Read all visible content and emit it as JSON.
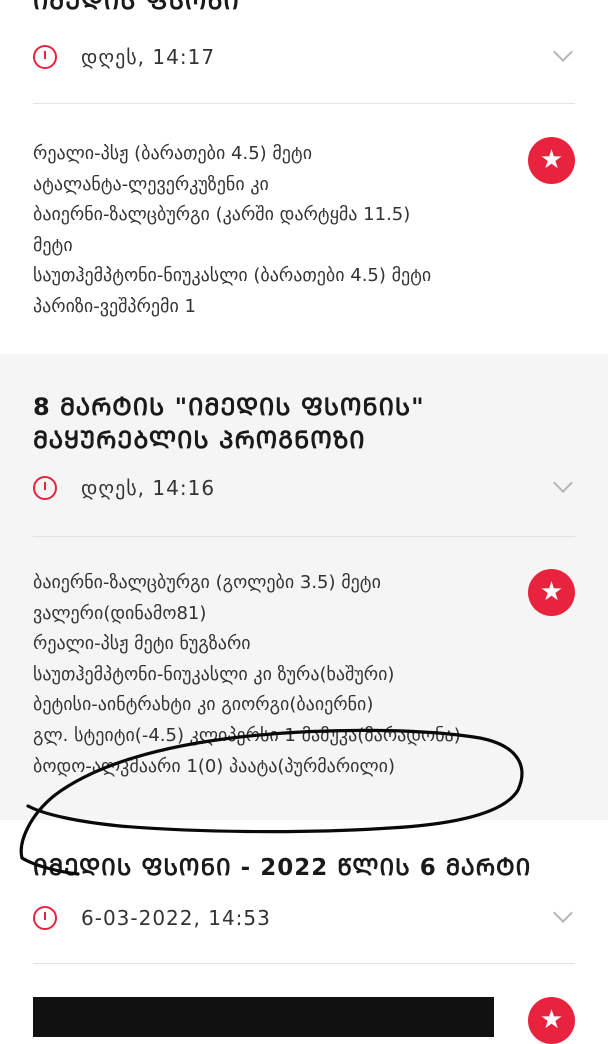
{
  "top_item": {
    "title_fragment": "ᲘᲛᲔᲓᲘᲡ ᲤᲡᲝᲜᲘ",
    "time": "დღეს, 14:17",
    "lines": [
      "რეალი-პსჟ (ბარათები 4.5) მეტი",
      "ატალანტა-ლევერკუზენი კი",
      "ბაიერნი-ზალცბურგი (კარში დარტყმა 11.5)",
      "მეტი",
      "საუთჰემპტონი-ნიუკასლი (ბარათები 4.5) მეტი",
      "პარიზი-ვეშპრემი 1"
    ]
  },
  "second_item": {
    "title_line1": "8 ᲛᲐᲠᲢᲘᲡ \"ᲘᲛᲔᲓᲘᲡ ᲤᲡᲝᲜᲘᲡ\"",
    "title_line2": "ᲛᲐᲧᲣᲠᲔᲑᲚᲘᲡ ᲞᲠᲝᲒᲜᲝᲖᲘ",
    "time": "დღეს, 14:16",
    "lines": [
      "ბაიერნი-ზალცბურგი (გოლები 3.5) მეტი",
      "ვალერი(დინამო81)",
      "რეალი-პსჟ მეტი ნუგზარი",
      "საუთჰემპტონი-ნიუკასლი კი ზურა(ხაშური)",
      "ბეტისი-აინტრახტი კი გიორგი(ბაიერნი)",
      "გლ. სტეიტი(-4.5) კლიპერსი 1 მამუკა(მარადონა)",
      "ბოდო-ალკმაარი 1(0) პაატა(პურმარილი)"
    ]
  },
  "third_item": {
    "title": "ᲘᲛᲔᲓᲘᲡ ᲤᲡᲝᲜᲘ - 2022 ᲬᲚᲘᲡ 6 ᲛᲐᲠᲢᲘ",
    "time": "6-03-2022, 14:53"
  },
  "icons": {
    "clock": "clock-icon",
    "chevron": "chevron-down-icon",
    "star": "star-icon"
  },
  "colors": {
    "accent": "#e8233d",
    "section_gray": "#f5f5f5"
  }
}
